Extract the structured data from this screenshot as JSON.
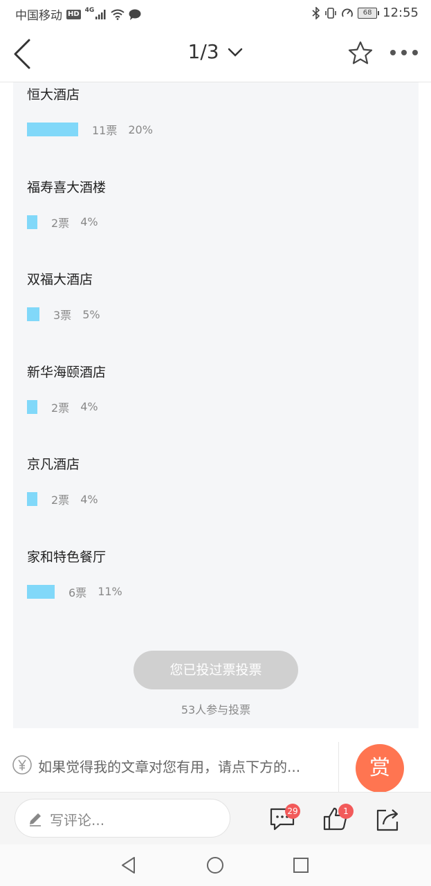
{
  "status_bar": {
    "carrier": "中国移动",
    "hd": "HD",
    "network": "4G",
    "battery": "68",
    "time": "12:55"
  },
  "header": {
    "page_indicator": "1/3"
  },
  "poll": {
    "options": [
      {
        "name": "恒大酒店",
        "votes": "11票",
        "percent": "20%",
        "share": 0.2
      },
      {
        "name": "福寿喜大酒楼",
        "votes": "2票",
        "percent": "4%",
        "share": 0.04
      },
      {
        "name": "双福大酒店",
        "votes": "3票",
        "percent": "5%",
        "share": 0.05
      },
      {
        "name": "新华海颐酒店",
        "votes": "2票",
        "percent": "4%",
        "share": 0.04
      },
      {
        "name": "京凡酒店",
        "votes": "2票",
        "percent": "4%",
        "share": 0.04
      },
      {
        "name": "家和特色餐厅",
        "votes": "6票",
        "percent": "11%",
        "share": 0.11
      }
    ],
    "vote_button_label": "您已投过票投票",
    "participants": "53人参与投票",
    "bar_color": "#81d8f9"
  },
  "reward": {
    "text": "如果觉得我的文章对您有用，请点下方的...",
    "button_label": "赏",
    "button_color": "#ff7551"
  },
  "comment_bar": {
    "placeholder": "写评论...",
    "comment_count": "29",
    "like_count": "1"
  }
}
